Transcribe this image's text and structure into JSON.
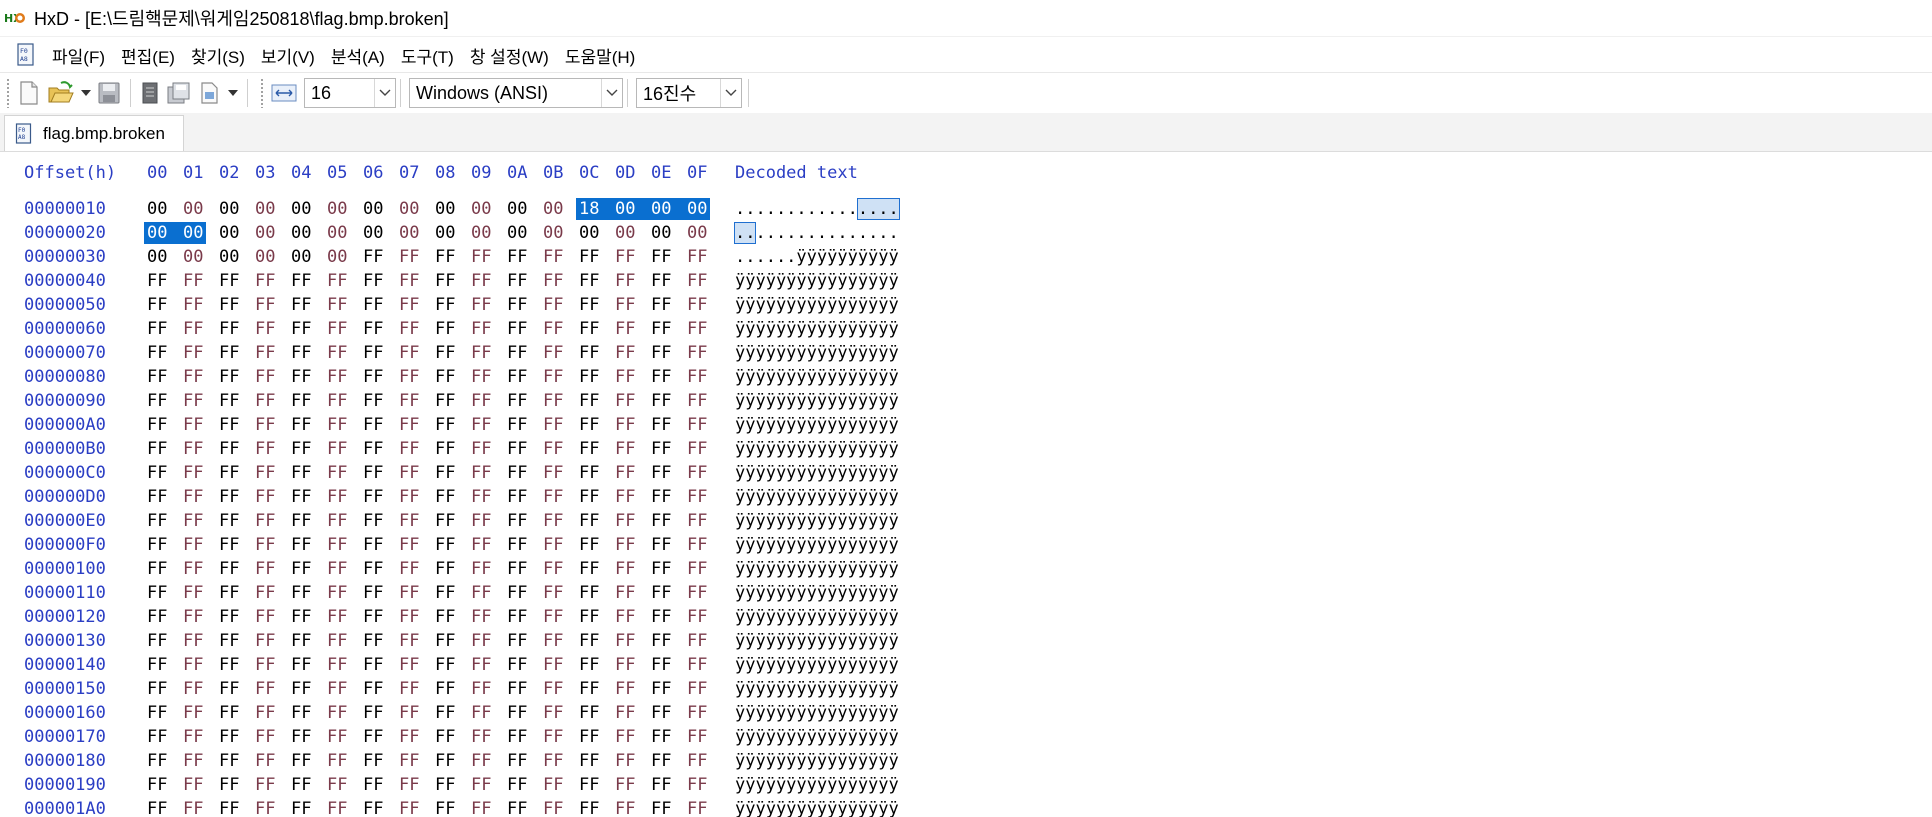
{
  "window": {
    "title": "HxD - [E:\\드림핵문제\\워게임250818\\flag.bmp.broken]"
  },
  "menu": {
    "items": [
      "파일(F)",
      "편집(E)",
      "찾기(S)",
      "보기(V)",
      "분석(A)",
      "도구(T)",
      "창 설정(W)",
      "도움말(H)"
    ]
  },
  "toolbar": {
    "bytes_per_row": "16",
    "encoding": "Windows (ANSI)",
    "number_base": "16진수"
  },
  "tab": {
    "label": "flag.bmp.broken"
  },
  "hex": {
    "offset_header": "Offset(h)",
    "column_headers": [
      "00",
      "01",
      "02",
      "03",
      "04",
      "05",
      "06",
      "07",
      "08",
      "09",
      "0A",
      "0B",
      "0C",
      "0D",
      "0E",
      "0F"
    ],
    "decoded_header": "Decoded text",
    "selection": {
      "start_offset": "0000001C",
      "end_offset": "00000021"
    },
    "rows": [
      {
        "offset": "00000010",
        "bytes": [
          "00",
          "00",
          "00",
          "00",
          "00",
          "00",
          "00",
          "00",
          "00",
          "00",
          "00",
          "00",
          "18",
          "00",
          "00",
          "00"
        ],
        "text": "............",
        "text_sel": "....",
        "text_rest": ""
      },
      {
        "offset": "00000020",
        "bytes": [
          "00",
          "00",
          "00",
          "00",
          "00",
          "00",
          "00",
          "00",
          "00",
          "00",
          "00",
          "00",
          "00",
          "00",
          "00",
          "00"
        ],
        "text": "",
        "text_sel": "..",
        "text_rest": ".............."
      },
      {
        "offset": "00000030",
        "bytes": [
          "00",
          "00",
          "00",
          "00",
          "00",
          "00",
          "FF",
          "FF",
          "FF",
          "FF",
          "FF",
          "FF",
          "FF",
          "FF",
          "FF",
          "FF"
        ],
        "text": "......ÿÿÿÿÿÿÿÿÿÿ",
        "text_sel": "",
        "text_rest": ""
      },
      {
        "offset": "00000040",
        "bytes": [
          "FF",
          "FF",
          "FF",
          "FF",
          "FF",
          "FF",
          "FF",
          "FF",
          "FF",
          "FF",
          "FF",
          "FF",
          "FF",
          "FF",
          "FF",
          "FF"
        ],
        "text": "ÿÿÿÿÿÿÿÿÿÿÿÿÿÿÿÿ",
        "text_sel": "",
        "text_rest": ""
      },
      {
        "offset": "00000050",
        "bytes": [
          "FF",
          "FF",
          "FF",
          "FF",
          "FF",
          "FF",
          "FF",
          "FF",
          "FF",
          "FF",
          "FF",
          "FF",
          "FF",
          "FF",
          "FF",
          "FF"
        ],
        "text": "ÿÿÿÿÿÿÿÿÿÿÿÿÿÿÿÿ",
        "text_sel": "",
        "text_rest": ""
      },
      {
        "offset": "00000060",
        "bytes": [
          "FF",
          "FF",
          "FF",
          "FF",
          "FF",
          "FF",
          "FF",
          "FF",
          "FF",
          "FF",
          "FF",
          "FF",
          "FF",
          "FF",
          "FF",
          "FF"
        ],
        "text": "ÿÿÿÿÿÿÿÿÿÿÿÿÿÿÿÿ",
        "text_sel": "",
        "text_rest": ""
      },
      {
        "offset": "00000070",
        "bytes": [
          "FF",
          "FF",
          "FF",
          "FF",
          "FF",
          "FF",
          "FF",
          "FF",
          "FF",
          "FF",
          "FF",
          "FF",
          "FF",
          "FF",
          "FF",
          "FF"
        ],
        "text": "ÿÿÿÿÿÿÿÿÿÿÿÿÿÿÿÿ",
        "text_sel": "",
        "text_rest": ""
      },
      {
        "offset": "00000080",
        "bytes": [
          "FF",
          "FF",
          "FF",
          "FF",
          "FF",
          "FF",
          "FF",
          "FF",
          "FF",
          "FF",
          "FF",
          "FF",
          "FF",
          "FF",
          "FF",
          "FF"
        ],
        "text": "ÿÿÿÿÿÿÿÿÿÿÿÿÿÿÿÿ",
        "text_sel": "",
        "text_rest": ""
      },
      {
        "offset": "00000090",
        "bytes": [
          "FF",
          "FF",
          "FF",
          "FF",
          "FF",
          "FF",
          "FF",
          "FF",
          "FF",
          "FF",
          "FF",
          "FF",
          "FF",
          "FF",
          "FF",
          "FF"
        ],
        "text": "ÿÿÿÿÿÿÿÿÿÿÿÿÿÿÿÿ",
        "text_sel": "",
        "text_rest": ""
      },
      {
        "offset": "000000A0",
        "bytes": [
          "FF",
          "FF",
          "FF",
          "FF",
          "FF",
          "FF",
          "FF",
          "FF",
          "FF",
          "FF",
          "FF",
          "FF",
          "FF",
          "FF",
          "FF",
          "FF"
        ],
        "text": "ÿÿÿÿÿÿÿÿÿÿÿÿÿÿÿÿ",
        "text_sel": "",
        "text_rest": ""
      },
      {
        "offset": "000000B0",
        "bytes": [
          "FF",
          "FF",
          "FF",
          "FF",
          "FF",
          "FF",
          "FF",
          "FF",
          "FF",
          "FF",
          "FF",
          "FF",
          "FF",
          "FF",
          "FF",
          "FF"
        ],
        "text": "ÿÿÿÿÿÿÿÿÿÿÿÿÿÿÿÿ",
        "text_sel": "",
        "text_rest": ""
      },
      {
        "offset": "000000C0",
        "bytes": [
          "FF",
          "FF",
          "FF",
          "FF",
          "FF",
          "FF",
          "FF",
          "FF",
          "FF",
          "FF",
          "FF",
          "FF",
          "FF",
          "FF",
          "FF",
          "FF"
        ],
        "text": "ÿÿÿÿÿÿÿÿÿÿÿÿÿÿÿÿ",
        "text_sel": "",
        "text_rest": ""
      },
      {
        "offset": "000000D0",
        "bytes": [
          "FF",
          "FF",
          "FF",
          "FF",
          "FF",
          "FF",
          "FF",
          "FF",
          "FF",
          "FF",
          "FF",
          "FF",
          "FF",
          "FF",
          "FF",
          "FF"
        ],
        "text": "ÿÿÿÿÿÿÿÿÿÿÿÿÿÿÿÿ",
        "text_sel": "",
        "text_rest": ""
      },
      {
        "offset": "000000E0",
        "bytes": [
          "FF",
          "FF",
          "FF",
          "FF",
          "FF",
          "FF",
          "FF",
          "FF",
          "FF",
          "FF",
          "FF",
          "FF",
          "FF",
          "FF",
          "FF",
          "FF"
        ],
        "text": "ÿÿÿÿÿÿÿÿÿÿÿÿÿÿÿÿ",
        "text_sel": "",
        "text_rest": ""
      },
      {
        "offset": "000000F0",
        "bytes": [
          "FF",
          "FF",
          "FF",
          "FF",
          "FF",
          "FF",
          "FF",
          "FF",
          "FF",
          "FF",
          "FF",
          "FF",
          "FF",
          "FF",
          "FF",
          "FF"
        ],
        "text": "ÿÿÿÿÿÿÿÿÿÿÿÿÿÿÿÿ",
        "text_sel": "",
        "text_rest": ""
      },
      {
        "offset": "00000100",
        "bytes": [
          "FF",
          "FF",
          "FF",
          "FF",
          "FF",
          "FF",
          "FF",
          "FF",
          "FF",
          "FF",
          "FF",
          "FF",
          "FF",
          "FF",
          "FF",
          "FF"
        ],
        "text": "ÿÿÿÿÿÿÿÿÿÿÿÿÿÿÿÿ",
        "text_sel": "",
        "text_rest": ""
      },
      {
        "offset": "00000110",
        "bytes": [
          "FF",
          "FF",
          "FF",
          "FF",
          "FF",
          "FF",
          "FF",
          "FF",
          "FF",
          "FF",
          "FF",
          "FF",
          "FF",
          "FF",
          "FF",
          "FF"
        ],
        "text": "ÿÿÿÿÿÿÿÿÿÿÿÿÿÿÿÿ",
        "text_sel": "",
        "text_rest": ""
      },
      {
        "offset": "00000120",
        "bytes": [
          "FF",
          "FF",
          "FF",
          "FF",
          "FF",
          "FF",
          "FF",
          "FF",
          "FF",
          "FF",
          "FF",
          "FF",
          "FF",
          "FF",
          "FF",
          "FF"
        ],
        "text": "ÿÿÿÿÿÿÿÿÿÿÿÿÿÿÿÿ",
        "text_sel": "",
        "text_rest": ""
      },
      {
        "offset": "00000130",
        "bytes": [
          "FF",
          "FF",
          "FF",
          "FF",
          "FF",
          "FF",
          "FF",
          "FF",
          "FF",
          "FF",
          "FF",
          "FF",
          "FF",
          "FF",
          "FF",
          "FF"
        ],
        "text": "ÿÿÿÿÿÿÿÿÿÿÿÿÿÿÿÿ",
        "text_sel": "",
        "text_rest": ""
      },
      {
        "offset": "00000140",
        "bytes": [
          "FF",
          "FF",
          "FF",
          "FF",
          "FF",
          "FF",
          "FF",
          "FF",
          "FF",
          "FF",
          "FF",
          "FF",
          "FF",
          "FF",
          "FF",
          "FF"
        ],
        "text": "ÿÿÿÿÿÿÿÿÿÿÿÿÿÿÿÿ",
        "text_sel": "",
        "text_rest": ""
      },
      {
        "offset": "00000150",
        "bytes": [
          "FF",
          "FF",
          "FF",
          "FF",
          "FF",
          "FF",
          "FF",
          "FF",
          "FF",
          "FF",
          "FF",
          "FF",
          "FF",
          "FF",
          "FF",
          "FF"
        ],
        "text": "ÿÿÿÿÿÿÿÿÿÿÿÿÿÿÿÿ",
        "text_sel": "",
        "text_rest": ""
      },
      {
        "offset": "00000160",
        "bytes": [
          "FF",
          "FF",
          "FF",
          "FF",
          "FF",
          "FF",
          "FF",
          "FF",
          "FF",
          "FF",
          "FF",
          "FF",
          "FF",
          "FF",
          "FF",
          "FF"
        ],
        "text": "ÿÿÿÿÿÿÿÿÿÿÿÿÿÿÿÿ",
        "text_sel": "",
        "text_rest": ""
      },
      {
        "offset": "00000170",
        "bytes": [
          "FF",
          "FF",
          "FF",
          "FF",
          "FF",
          "FF",
          "FF",
          "FF",
          "FF",
          "FF",
          "FF",
          "FF",
          "FF",
          "FF",
          "FF",
          "FF"
        ],
        "text": "ÿÿÿÿÿÿÿÿÿÿÿÿÿÿÿÿ",
        "text_sel": "",
        "text_rest": ""
      },
      {
        "offset": "00000180",
        "bytes": [
          "FF",
          "FF",
          "FF",
          "FF",
          "FF",
          "FF",
          "FF",
          "FF",
          "FF",
          "FF",
          "FF",
          "FF",
          "FF",
          "FF",
          "FF",
          "FF"
        ],
        "text": "ÿÿÿÿÿÿÿÿÿÿÿÿÿÿÿÿ",
        "text_sel": "",
        "text_rest": ""
      },
      {
        "offset": "00000190",
        "bytes": [
          "FF",
          "FF",
          "FF",
          "FF",
          "FF",
          "FF",
          "FF",
          "FF",
          "FF",
          "FF",
          "FF",
          "FF",
          "FF",
          "FF",
          "FF",
          "FF"
        ],
        "text": "ÿÿÿÿÿÿÿÿÿÿÿÿÿÿÿÿ",
        "text_sel": "",
        "text_rest": ""
      },
      {
        "offset": "000001A0",
        "bytes": [
          "FF",
          "FF",
          "FF",
          "FF",
          "FF",
          "FF",
          "FF",
          "FF",
          "FF",
          "FF",
          "FF",
          "FF",
          "FF",
          "FF",
          "FF",
          "FF"
        ],
        "text": "ÿÿÿÿÿÿÿÿÿÿÿÿÿÿÿÿ",
        "text_sel": "",
        "text_rest": ""
      }
    ]
  },
  "colors": {
    "offset_blue": "#2b3ec4",
    "byte_even": "#000000",
    "byte_odd": "#7a3a4a",
    "selection": "#0a6fd0",
    "decoded_selection": "#cfe1f5"
  },
  "icons": {
    "app": "hxd-app-icon",
    "new": "new-file-icon",
    "open": "open-folder-icon",
    "save": "save-disk-icon",
    "properties": "file-properties-icon",
    "save_all": "save-all-icon",
    "export": "export-icon",
    "bytes_per_row": "bytes-per-row-icon"
  }
}
